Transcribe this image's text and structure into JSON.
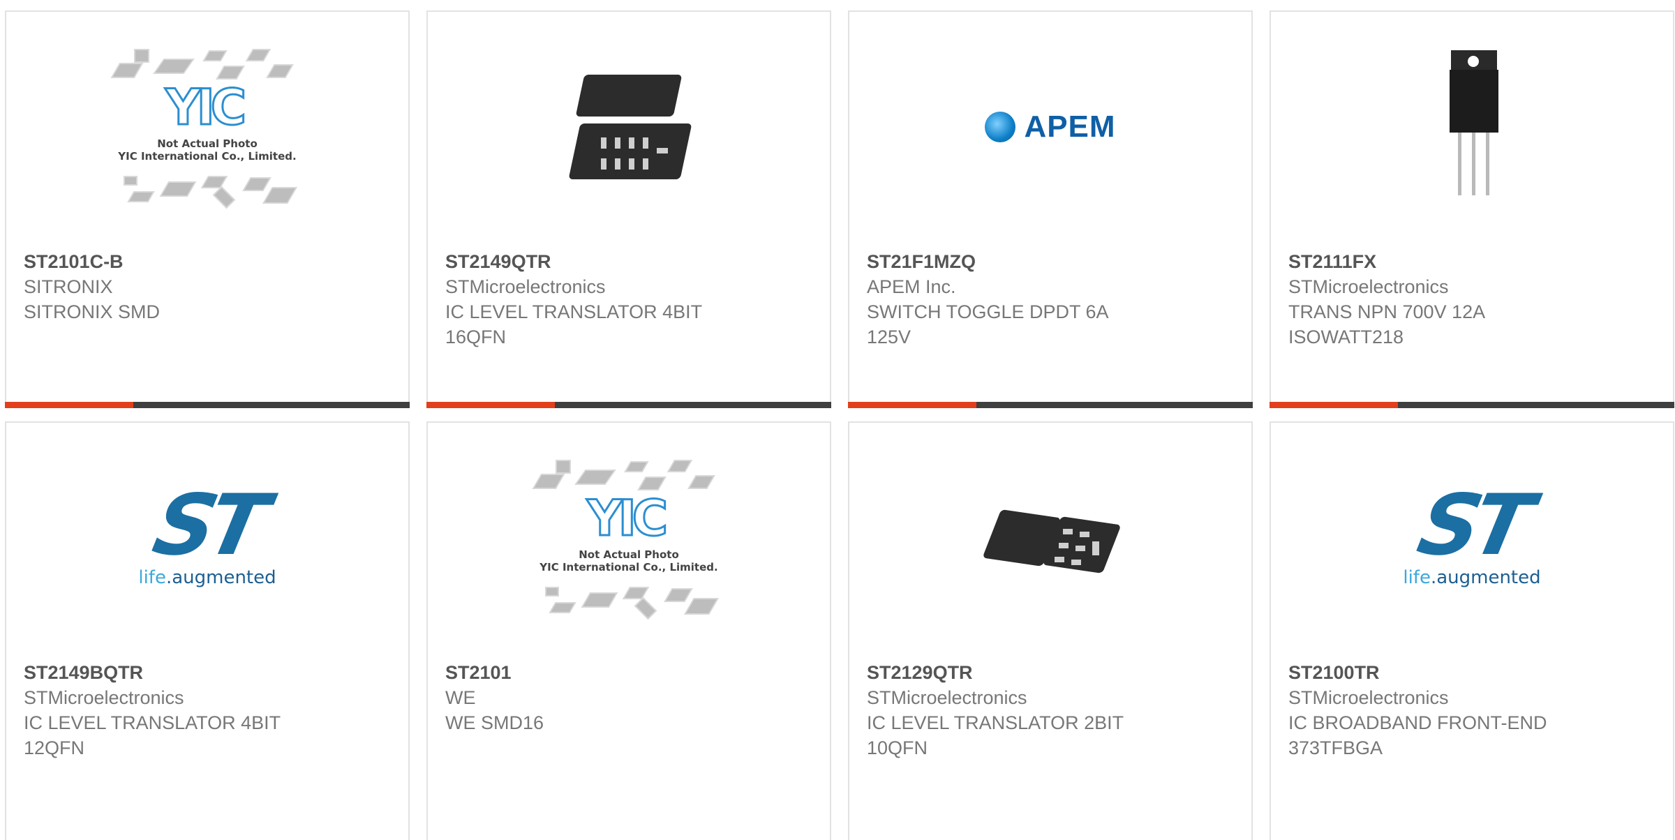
{
  "products": [
    {
      "part_number": "ST2101C-B",
      "manufacturer": "SITRONIX",
      "description": "SITRONIX SMD",
      "image": "yic-placeholder",
      "image_caption": [
        "Not Actual Photo",
        "YIC International Co., Limited."
      ]
    },
    {
      "part_number": "ST2149QTR",
      "manufacturer": "STMicroelectronics",
      "description": "IC LEVEL TRANSLATOR 4BIT\n16QFN",
      "image": "qfn-package-photo"
    },
    {
      "part_number": "ST21F1MZQ",
      "manufacturer": "APEM Inc.",
      "description": "SWITCH TOGGLE DPDT 6A\n125V",
      "image": "apem-logo",
      "logo_text": "APEM"
    },
    {
      "part_number": "ST2111FX",
      "manufacturer": "STMicroelectronics",
      "description": "TRANS NPN 700V 12A\nISOWATT218",
      "image": "to-218-transistor-photo"
    },
    {
      "part_number": "ST2149BQTR",
      "manufacturer": "STMicroelectronics",
      "description": "IC LEVEL TRANSLATOR 4BIT\n12QFN",
      "image": "st-logo",
      "logo_tagline": [
        "life",
        ".augmented"
      ]
    },
    {
      "part_number": "ST2101",
      "manufacturer": "WE",
      "description": "WE SMD16",
      "image": "yic-placeholder",
      "image_caption": [
        "Not Actual Photo",
        "YIC International Co., Limited."
      ]
    },
    {
      "part_number": "ST2129QTR",
      "manufacturer": "STMicroelectronics",
      "description": "IC LEVEL TRANSLATOR 2BIT\n10QFN",
      "image": "qfn-package-photo"
    },
    {
      "part_number": "ST2100TR",
      "manufacturer": "STMicroelectronics",
      "description": "IC BROADBAND FRONT-END\n373TFBGA",
      "image": "st-logo",
      "logo_tagline": [
        "life",
        ".augmented"
      ]
    }
  ],
  "colors": {
    "accent": "#e2401b",
    "bar": "#3f3f3f",
    "border": "#e2e2e2"
  }
}
